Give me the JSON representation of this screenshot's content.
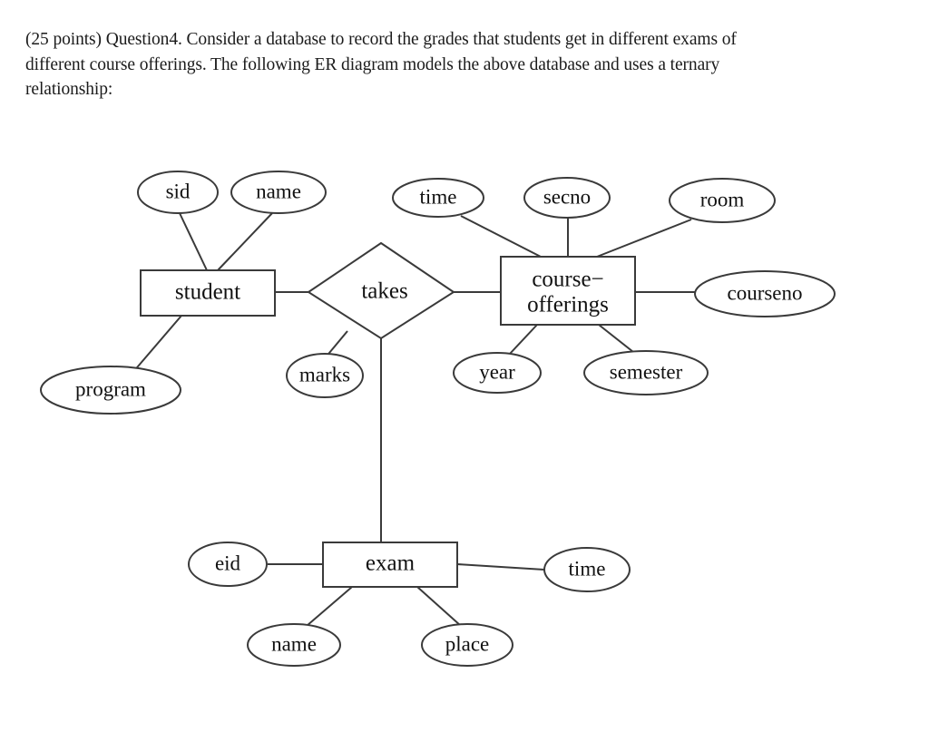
{
  "question": {
    "points_label": "(25 points)",
    "number_label": "Question4.",
    "body": "Consider a database to record the grades that students get in different exams of different course offerings. The following ER diagram models the above database and uses a ternary relationship:",
    "full_text": "(25 points)  Question4. Consider a database to record the grades that students get in different exams of different course offerings. The following ER diagram models the above database and uses a ternary relationship:"
  },
  "diagram": {
    "type": "er-diagram",
    "stroke_color": "#3a3a3a",
    "fill_color": "#ffffff",
    "text_color": "#111111",
    "entities": [
      {
        "id": "student",
        "label": "student",
        "shape": "rectangle"
      },
      {
        "id": "course-offerings",
        "label_line1": "course−",
        "label_line2": "offerings",
        "label": "course−offerings",
        "shape": "rectangle"
      },
      {
        "id": "exam",
        "label": "exam",
        "shape": "rectangle"
      }
    ],
    "relationships": [
      {
        "id": "takes",
        "label": "takes",
        "shape": "diamond",
        "degree": "ternary",
        "connects": [
          "student",
          "course-offerings",
          "exam"
        ]
      }
    ],
    "attributes": [
      {
        "id": "sid",
        "label": "sid",
        "owner": "student"
      },
      {
        "id": "student-name",
        "label": "name",
        "owner": "student"
      },
      {
        "id": "program",
        "label": "program",
        "owner": "student"
      },
      {
        "id": "marks",
        "label": "marks",
        "owner": "takes"
      },
      {
        "id": "co-time",
        "label": "time",
        "owner": "course-offerings"
      },
      {
        "id": "secno",
        "label": "secno",
        "owner": "course-offerings"
      },
      {
        "id": "room",
        "label": "room",
        "owner": "course-offerings"
      },
      {
        "id": "courseno",
        "label": "courseno",
        "owner": "course-offerings"
      },
      {
        "id": "year",
        "label": "year",
        "owner": "course-offerings"
      },
      {
        "id": "semester",
        "label": "semester",
        "owner": "course-offerings"
      },
      {
        "id": "eid",
        "label": "eid",
        "owner": "exam"
      },
      {
        "id": "exam-name",
        "label": "name",
        "owner": "exam"
      },
      {
        "id": "place",
        "label": "place",
        "owner": "exam"
      },
      {
        "id": "exam-time",
        "label": "time",
        "owner": "exam"
      }
    ]
  }
}
